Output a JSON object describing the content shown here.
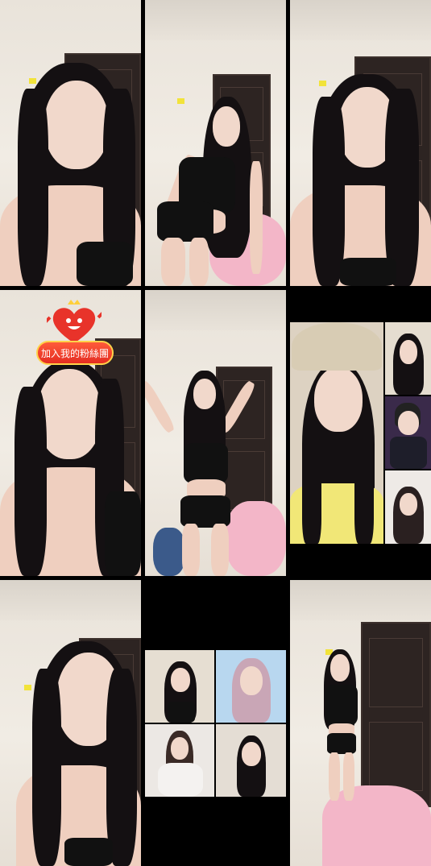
{
  "grid": {
    "tiles": [
      {
        "id": "top-left"
      },
      {
        "id": "top-middle"
      },
      {
        "id": "top-right"
      },
      {
        "id": "middle-left"
      },
      {
        "id": "center"
      },
      {
        "id": "middle-right-multiview"
      },
      {
        "id": "bottom-left"
      },
      {
        "id": "bottom-middle-multiview"
      },
      {
        "id": "bottom-right"
      }
    ]
  },
  "fan_club_badge": {
    "label": "加入我的粉絲團",
    "icon": "heart-mascot-icon"
  },
  "colors": {
    "background": "#000000",
    "badge": "#e52d22",
    "badge_border": "#ffd24a"
  }
}
